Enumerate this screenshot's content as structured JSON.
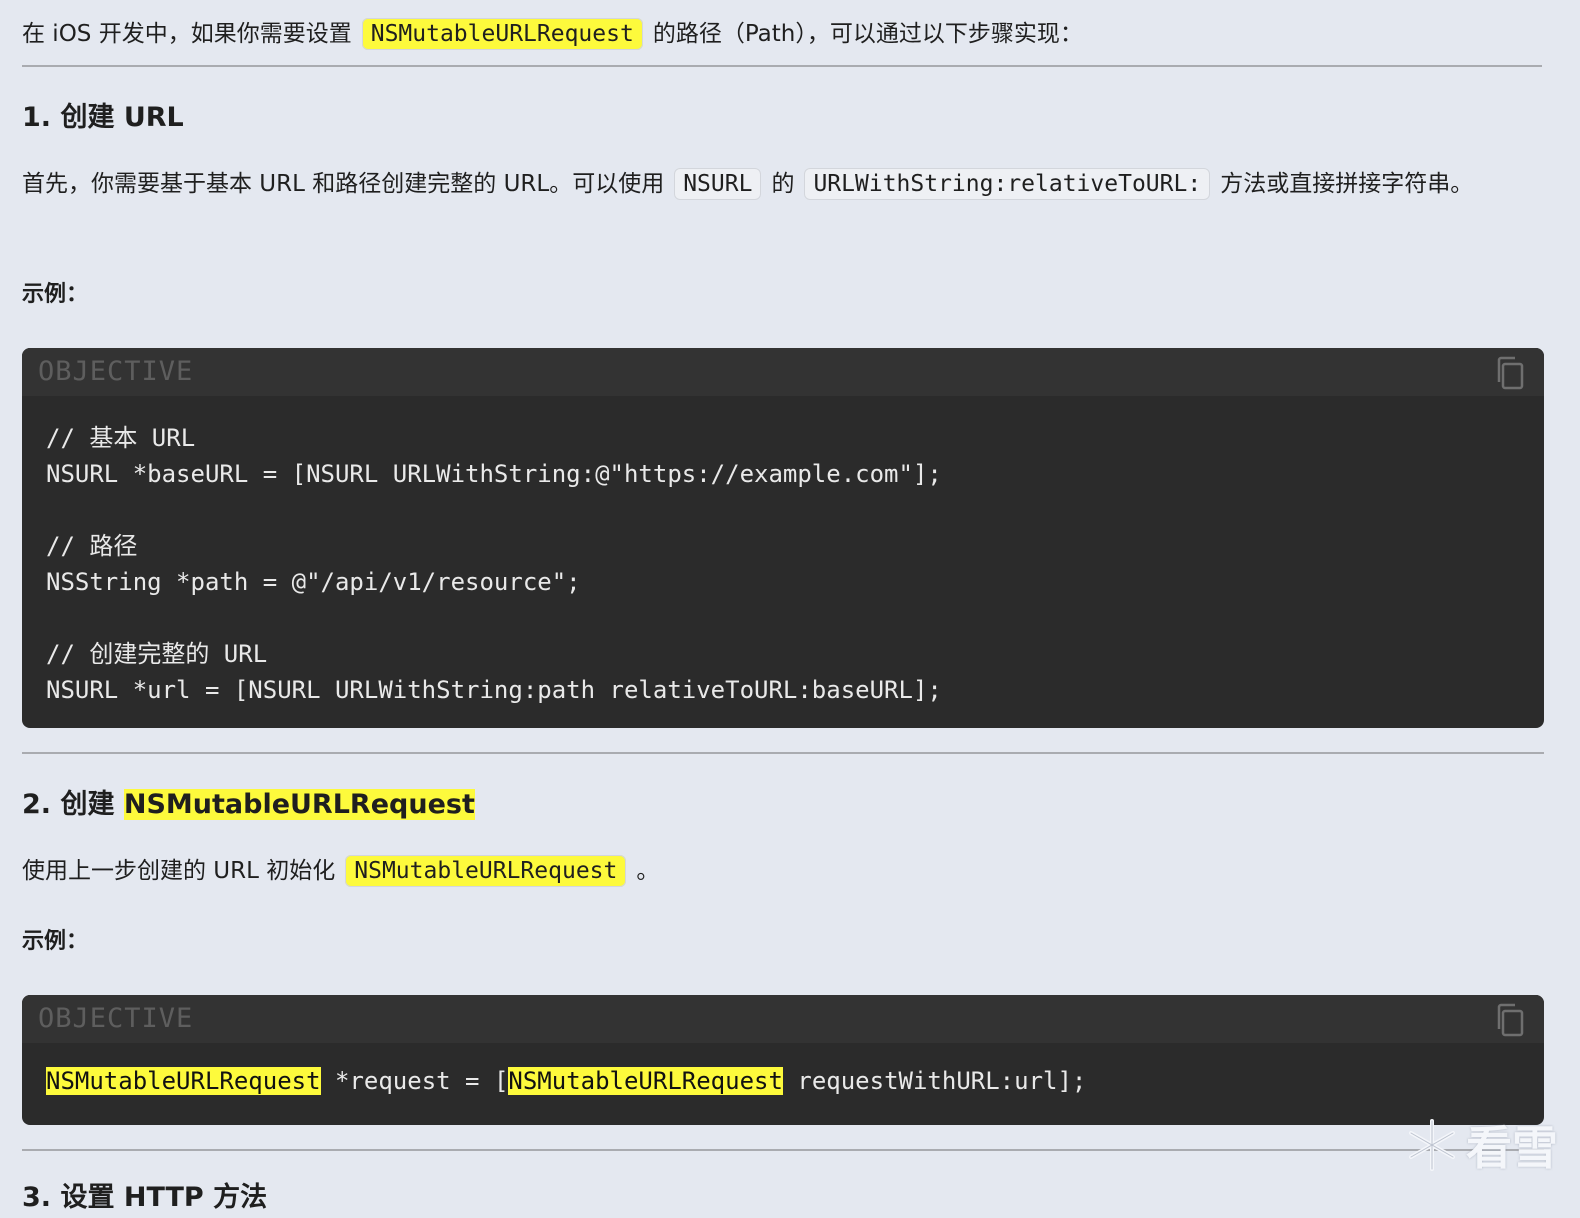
{
  "intro": {
    "before": "在 iOS 开发中，如果你需要设置",
    "code": "NSMutableURLRequest",
    "after": "的路径（Path），可以通过以下步骤实现："
  },
  "section1": {
    "heading": "1. 创建 URL",
    "p_before": "首先，你需要基于基本 URL 和路径创建完整的 URL。可以使用",
    "code1": "NSURL",
    "p_mid": "的",
    "code2": "URLWithString:relativeToURL:",
    "p_after": "方法或直接拼接字符串。",
    "example_label": "示例：",
    "code_lang": "OBJECTIVE",
    "code_lines": [
      "// 基本 URL",
      "NSURL *baseURL = [NSURL URLWithString:@\"https://example.com\"];",
      "",
      "// 路径",
      "NSString *path = @\"/api/v1/resource\";",
      "",
      "// 创建完整的 URL",
      "NSURL *url = [NSURL URLWithString:path relativeToURL:baseURL];"
    ]
  },
  "section2": {
    "heading_prefix": "2. 创建",
    "heading_code": "NSMutableURLRequest",
    "p_before": "使用上一步创建的 URL 初始化",
    "code": "NSMutableURLRequest",
    "p_after": "。",
    "example_label": "示例：",
    "code_lang": "OBJECTIVE",
    "code_line": {
      "part1": "NSMutableURLRequest",
      "part2": " *request = [",
      "part3": "NSMutableURLRequest",
      "part4": " requestWithURL:url];"
    }
  },
  "section3": {
    "heading": "3. 设置 HTTP 方法"
  },
  "watermark": {
    "text": "看雪",
    "icon": "snowflake-icon"
  },
  "colors": {
    "background": "#e4e8f0",
    "highlight": "#fdfa3c",
    "code_bg": "#2b2b2b"
  }
}
